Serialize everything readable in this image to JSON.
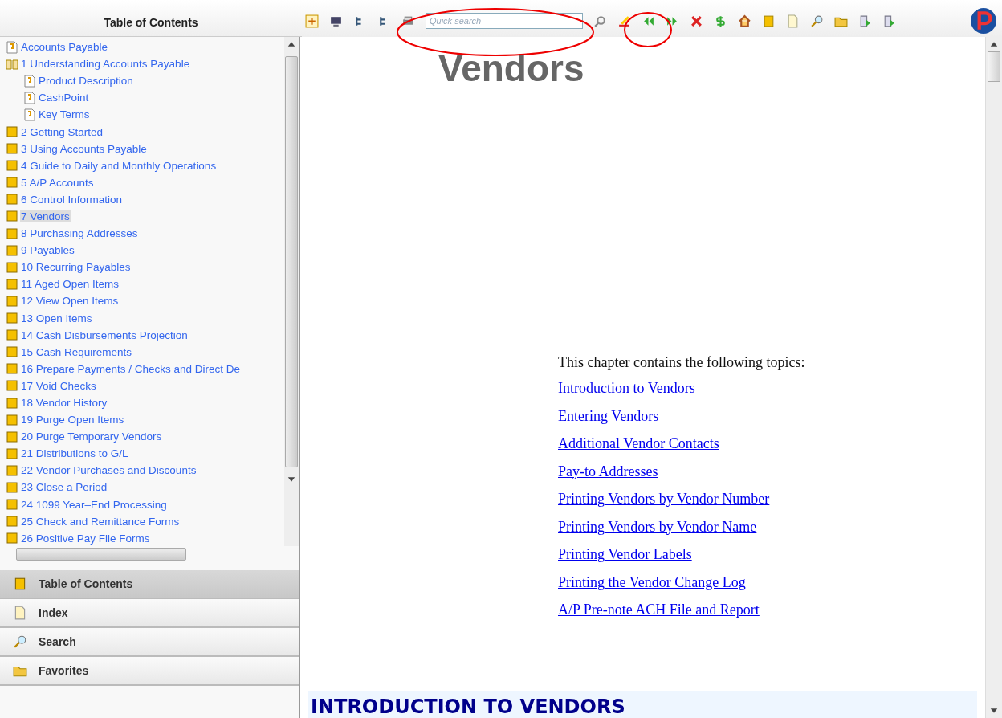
{
  "left_panel": {
    "title": "Table of Contents"
  },
  "toolbar": {
    "search": {
      "placeholder": "Quick search"
    }
  },
  "toc": [
    {
      "label": "Accounts Payable",
      "kind": "page",
      "selected": false
    },
    {
      "label": "1 Understanding Accounts Payable",
      "kind": "book",
      "selected": false,
      "expanded": true,
      "children": [
        {
          "label": "Product Description",
          "kind": "page",
          "selected": false
        },
        {
          "label": "CashPoint",
          "kind": "page",
          "selected": false
        },
        {
          "label": "Key Terms",
          "kind": "page",
          "selected": false
        }
      ]
    },
    {
      "label": "2 Getting Started",
      "kind": "book",
      "selected": false,
      "expanded": false
    },
    {
      "label": "3 Using Accounts Payable",
      "kind": "book",
      "selected": false,
      "expanded": false
    },
    {
      "label": "4 Guide to Daily and Monthly Operations",
      "kind": "book",
      "selected": false,
      "expanded": false
    },
    {
      "label": "5 A/P Accounts",
      "kind": "book",
      "selected": false,
      "expanded": false
    },
    {
      "label": "6 Control Information",
      "kind": "book",
      "selected": false,
      "expanded": false
    },
    {
      "label": "7 Vendors",
      "kind": "book",
      "selected": true,
      "expanded": false
    },
    {
      "label": "8 Purchasing Addresses",
      "kind": "book",
      "selected": false,
      "expanded": false
    },
    {
      "label": "9 Payables",
      "kind": "book",
      "selected": false,
      "expanded": false
    },
    {
      "label": "10 Recurring Payables",
      "kind": "book",
      "selected": false,
      "expanded": false
    },
    {
      "label": "11 Aged Open Items",
      "kind": "book",
      "selected": false,
      "expanded": false
    },
    {
      "label": "12 View Open Items",
      "kind": "book",
      "selected": false,
      "expanded": false
    },
    {
      "label": "13 Open Items",
      "kind": "book",
      "selected": false,
      "expanded": false
    },
    {
      "label": "14 Cash Disbursements Projection",
      "kind": "book",
      "selected": false,
      "expanded": false
    },
    {
      "label": "15 Cash Requirements",
      "kind": "book",
      "selected": false,
      "expanded": false
    },
    {
      "label": "16 Prepare Payments / Checks and Direct De",
      "kind": "book",
      "selected": false,
      "expanded": false
    },
    {
      "label": "17 Void Checks",
      "kind": "book",
      "selected": false,
      "expanded": false
    },
    {
      "label": "18 Vendor History",
      "kind": "book",
      "selected": false,
      "expanded": false
    },
    {
      "label": "19 Purge Open Items",
      "kind": "book",
      "selected": false,
      "expanded": false
    },
    {
      "label": "20 Purge Temporary Vendors",
      "kind": "book",
      "selected": false,
      "expanded": false
    },
    {
      "label": "21 Distributions to G/L",
      "kind": "book",
      "selected": false,
      "expanded": false
    },
    {
      "label": "22 Vendor Purchases and Discounts",
      "kind": "book",
      "selected": false,
      "expanded": false
    },
    {
      "label": "23 Close a Period",
      "kind": "book",
      "selected": false,
      "expanded": false
    },
    {
      "label": "24 1099 Year–End Processing",
      "kind": "book",
      "selected": false,
      "expanded": false
    },
    {
      "label": "25 Check and Remittance Forms",
      "kind": "book",
      "selected": false,
      "expanded": false
    },
    {
      "label": "26 Positive Pay File Forms",
      "kind": "book",
      "selected": false,
      "expanded": false
    }
  ],
  "nav_tabs": [
    {
      "label": "Table of Contents",
      "kind": "toc",
      "selected": true
    },
    {
      "label": "Index",
      "kind": "index",
      "selected": false
    },
    {
      "label": "Search",
      "kind": "search",
      "selected": false
    },
    {
      "label": "Favorites",
      "kind": "favorites",
      "selected": false
    }
  ],
  "content": {
    "title": "Vendors",
    "intro": "This chapter contains the following topics:",
    "links": [
      "Introduction to Vendors",
      "Entering Vendors",
      "Additional Vendor Contacts",
      "Pay-to Addresses",
      "Printing Vendors by Vendor Number",
      "Printing Vendors by Vendor Name",
      "Printing Vendor Labels",
      "Printing the Vendor Change Log",
      "A/P Pre-note ACH File and Report"
    ],
    "section_heading": "INTRODUCTION TO VENDORS"
  }
}
